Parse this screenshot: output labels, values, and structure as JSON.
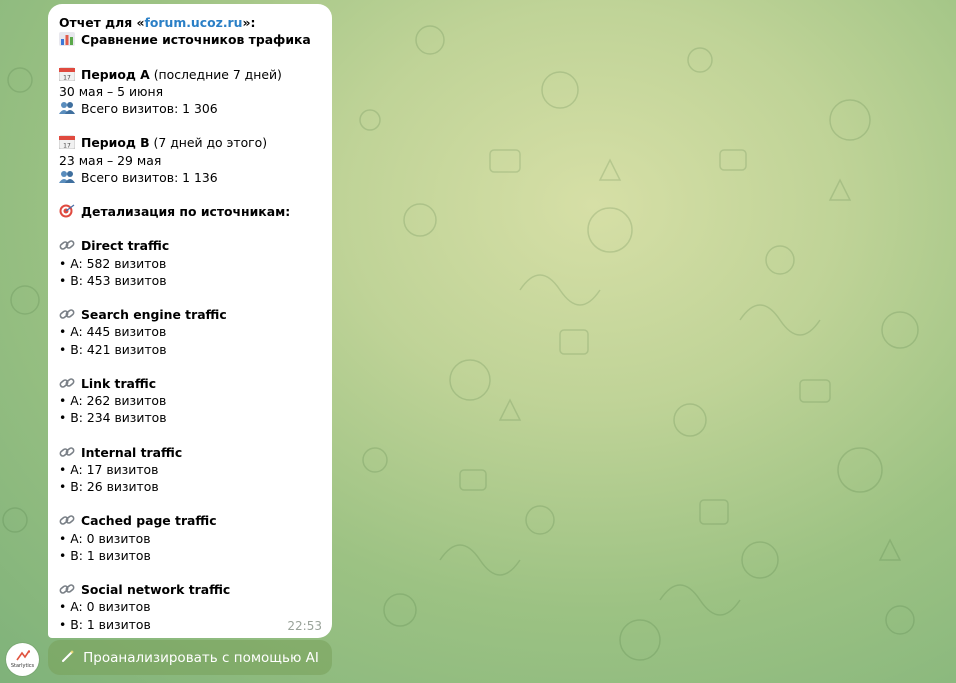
{
  "message": {
    "header_prefix": "Отчет для «",
    "site": "forum.ucoz.ru",
    "header_suffix": "»:",
    "title": "Сравнение источников трафика",
    "period_a": {
      "label": "Период А",
      "note": " (последние 7 дней)",
      "dates": "30 мая – 5 июня",
      "total": "Всего визитов: 1 306"
    },
    "period_b": {
      "label": "Период В",
      "note": " (7 дней до этого)",
      "dates": "23 мая – 29 мая",
      "total": "Всего визитов: 1 136"
    },
    "details_title": "Детализация по источникам:",
    "sources": [
      {
        "name": "Direct traffic",
        "a": "• A: 582 визитов",
        "b": "• B: 453 визитов"
      },
      {
        "name": "Search engine traffic",
        "a": "• A: 445 визитов",
        "b": "• B: 421 визитов"
      },
      {
        "name": "Link traffic",
        "a": "• A: 262 визитов",
        "b": "• B: 234 визитов"
      },
      {
        "name": "Internal traffic",
        "a": "• A: 17 визитов",
        "b": "• B: 26 визитов"
      },
      {
        "name": "Cached page traffic",
        "a": "• A: 0 визитов",
        "b": "• B: 1 визитов"
      },
      {
        "name": "Social network traffic",
        "a": "• A: 0 визитов",
        "b": "• B: 1 визитов"
      }
    ],
    "time": "22:53"
  },
  "keyboard": {
    "button_label": "Проанализировать с помощью AI"
  },
  "bot": {
    "avatar_text": "Starlytics"
  },
  "colors": {
    "link": "#2a7fc6",
    "button_bg": "#7fa05a"
  },
  "icons": [
    "chart-icon",
    "calendar-icon",
    "people-icon",
    "target-icon",
    "link-icon",
    "wand-icon"
  ]
}
